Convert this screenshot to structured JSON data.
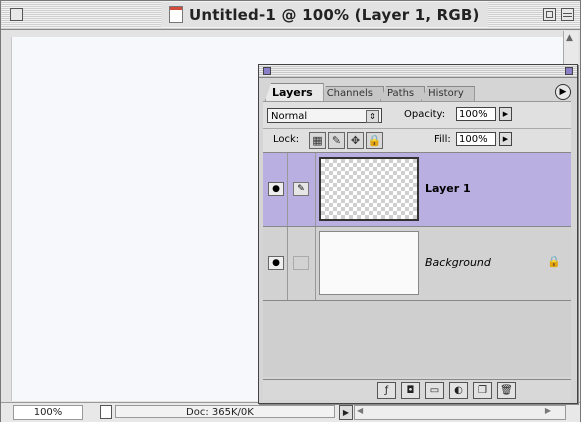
{
  "window": {
    "title": "Untitled-1 @ 100% (Layer 1, RGB)"
  },
  "status": {
    "zoom": "100%",
    "doc": "Doc: 365K/0K"
  },
  "palette": {
    "tabs": [
      "Layers",
      "Channels",
      "Paths",
      "History"
    ],
    "blend_mode": "Normal",
    "opacity_label": "Opacity:",
    "opacity": "100%",
    "lock_label": "Lock:",
    "fill_label": "Fill:",
    "fill": "100%",
    "layers": [
      {
        "name": "Layer 1"
      },
      {
        "name": "Background"
      }
    ]
  },
  "colors": {
    "active_layer": "#b9afe0"
  }
}
